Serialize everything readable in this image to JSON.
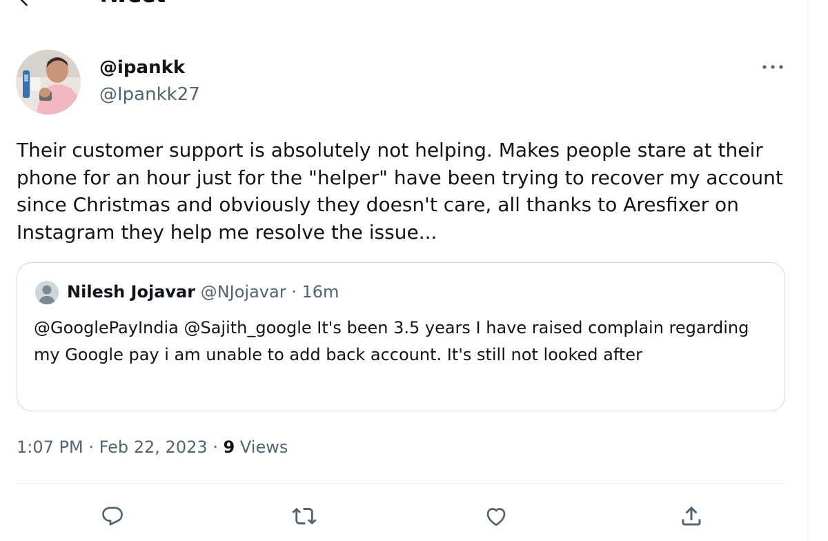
{
  "header": {
    "title": "Tweet",
    "back_icon": "arrow-left-icon"
  },
  "author": {
    "display_name": "@ipankk",
    "handle": "@Ipankk27"
  },
  "tweet": {
    "text": "Their customer support is absolutely not helping. Makes people stare at their phone for an hour just for the \"helper\" have been trying to recover my account since Christmas and obviously they doesn't care, all thanks to Aresfixer on Instagram they help me resolve the issue..."
  },
  "quote": {
    "name": "Nilesh Jojavar",
    "handle": "@NJojavar",
    "separator": "·",
    "time": "16m",
    "text": "@GooglePayIndia @Sajith_google  It's been 3.5 years I have raised complain regarding my Google pay i am unable to add back account. It's still not looked after"
  },
  "meta": {
    "time": "1:07 PM",
    "separator": "·",
    "date": "Feb 22, 2023",
    "views_count": "9",
    "views_label": "Views"
  },
  "actions": [
    {
      "name": "reply",
      "icon": "reply-icon"
    },
    {
      "name": "retweet",
      "icon": "retweet-icon"
    },
    {
      "name": "like",
      "icon": "heart-icon"
    },
    {
      "name": "share",
      "icon": "share-icon"
    }
  ],
  "colors": {
    "text_primary": "#0f1419",
    "text_secondary": "#536471",
    "border": "#cfd9de",
    "divider": "#eff3f4"
  }
}
